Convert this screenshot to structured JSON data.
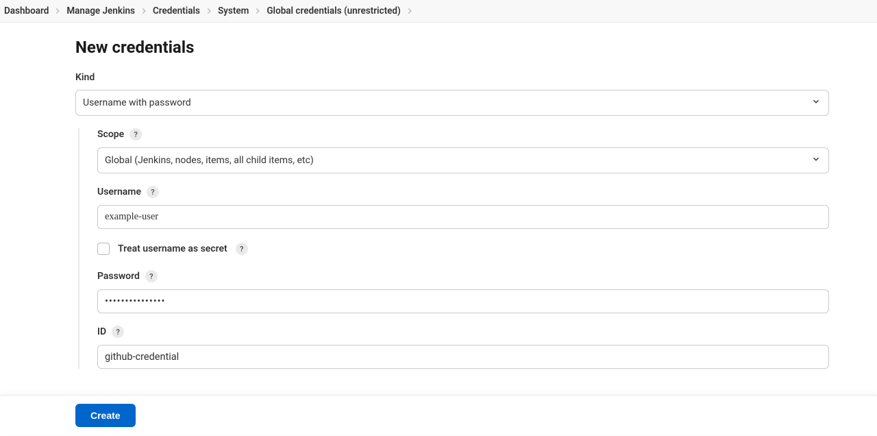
{
  "breadcrumb": {
    "items": [
      {
        "label": "Dashboard"
      },
      {
        "label": "Manage Jenkins"
      },
      {
        "label": "Credentials"
      },
      {
        "label": "System"
      },
      {
        "label": "Global credentials (unrestricted)"
      }
    ]
  },
  "page": {
    "title": "New credentials"
  },
  "form": {
    "kind_label": "Kind",
    "kind_value": "Username with password",
    "scope_label": "Scope",
    "scope_value": "Global (Jenkins, nodes, items, all child items, etc)",
    "username_label": "Username",
    "username_value": "example-user",
    "treat_secret_label": "Treat username as secret",
    "treat_secret_checked": false,
    "password_label": "Password",
    "password_value": "•••••••••••••••",
    "id_label": "ID",
    "id_value": "github-credential"
  },
  "actions": {
    "create_label": "Create"
  },
  "help": {
    "glyph": "?"
  }
}
